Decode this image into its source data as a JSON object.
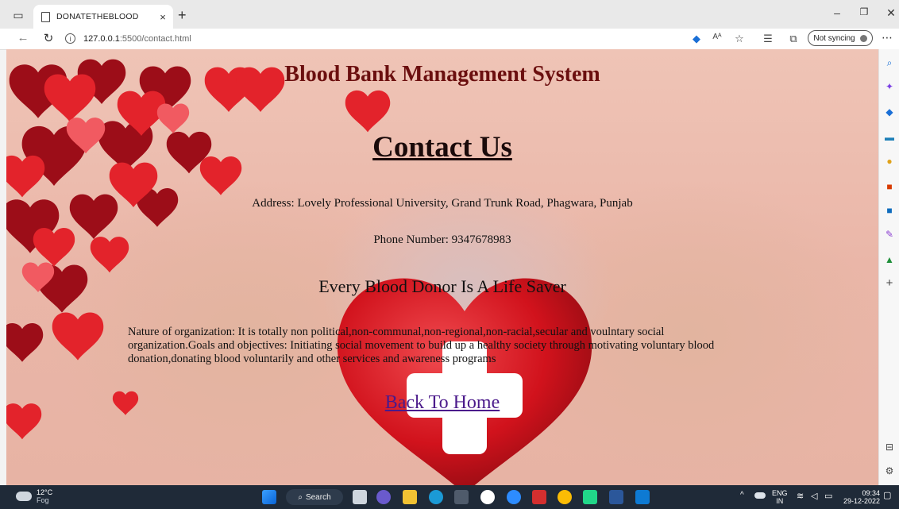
{
  "browser": {
    "tab_title": "DONATETHEBLOOD",
    "tab_close": "×",
    "new_tab": "+",
    "url_host": "127.0.0.1",
    "url_path": ":5500/contact.html",
    "sync_label": "Not syncing",
    "window_controls": {
      "minimize": "–",
      "maximize": "❐",
      "close": "✕"
    }
  },
  "page": {
    "site_title": "Blood Bank Management System",
    "heading": "Contact Us",
    "address": "Address: Lovely Professional University, Grand Trunk Road, Phagwara, Punjab",
    "phone": "Phone Number: 9347678983",
    "slogan": "Every Blood Donor Is A Life Saver",
    "about": "Nature of organization: It is totally non political,non-communal,non-regional,non-racial,secular and voulntary social organization.Goals and objectives: Initiating social movement to build up a healthy society through motivating voluntary blood donation,donating blood voluntarily and other services and awareness programs",
    "back_link": "Back To Home"
  },
  "taskbar": {
    "temperature": "12°C",
    "weather": "Fog",
    "search_label": "Search",
    "language": "ENG",
    "region": "IN",
    "time": "09:34",
    "date": "29-12-2022"
  },
  "colors": {
    "title": "#6b0f0f",
    "link": "#4b1a8b",
    "heart": "#d1121c",
    "taskbar": "#1f2a38"
  }
}
